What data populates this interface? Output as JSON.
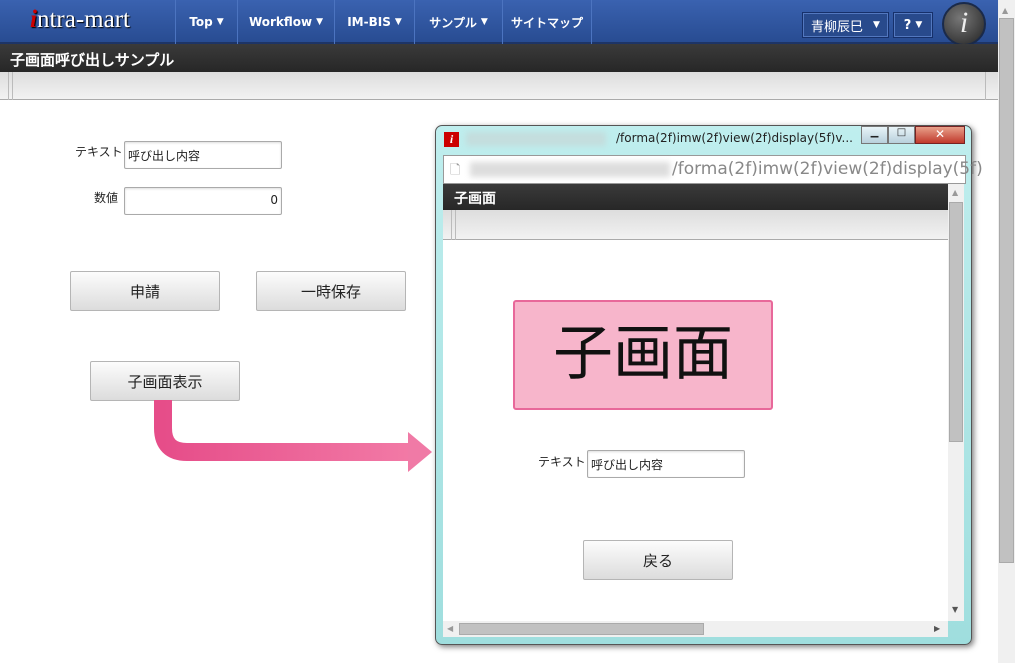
{
  "header": {
    "logo": "intra-mart",
    "nav": [
      {
        "label": "Top"
      },
      {
        "label": "Workflow"
      },
      {
        "label": "IM-BIS"
      },
      {
        "label": "サンプル"
      },
      {
        "label": "サイトマップ"
      }
    ],
    "user": "青柳辰巳",
    "help": "?"
  },
  "page": {
    "title": "子画面呼び出しサンプル"
  },
  "form": {
    "text_label": "テキスト",
    "text_value": "呼び出し内容",
    "number_label": "数値",
    "number_value": "0",
    "apply": "申請",
    "save": "一時保存",
    "open_child": "子画面表示"
  },
  "popup": {
    "window_title": "/forma(2f)imw(2f)view(2f)display(5f)v...",
    "address": "/forma(2f)imw(2f)view(2f)display(5f)",
    "header": "子画面",
    "banner": "子画面",
    "text_label": "テキスト",
    "text_value": "呼び出し内容",
    "back": "戻る"
  },
  "colors": {
    "accent": "#2f56a0",
    "arrow": "#ec5f95",
    "banner": "#f7b5cb"
  }
}
